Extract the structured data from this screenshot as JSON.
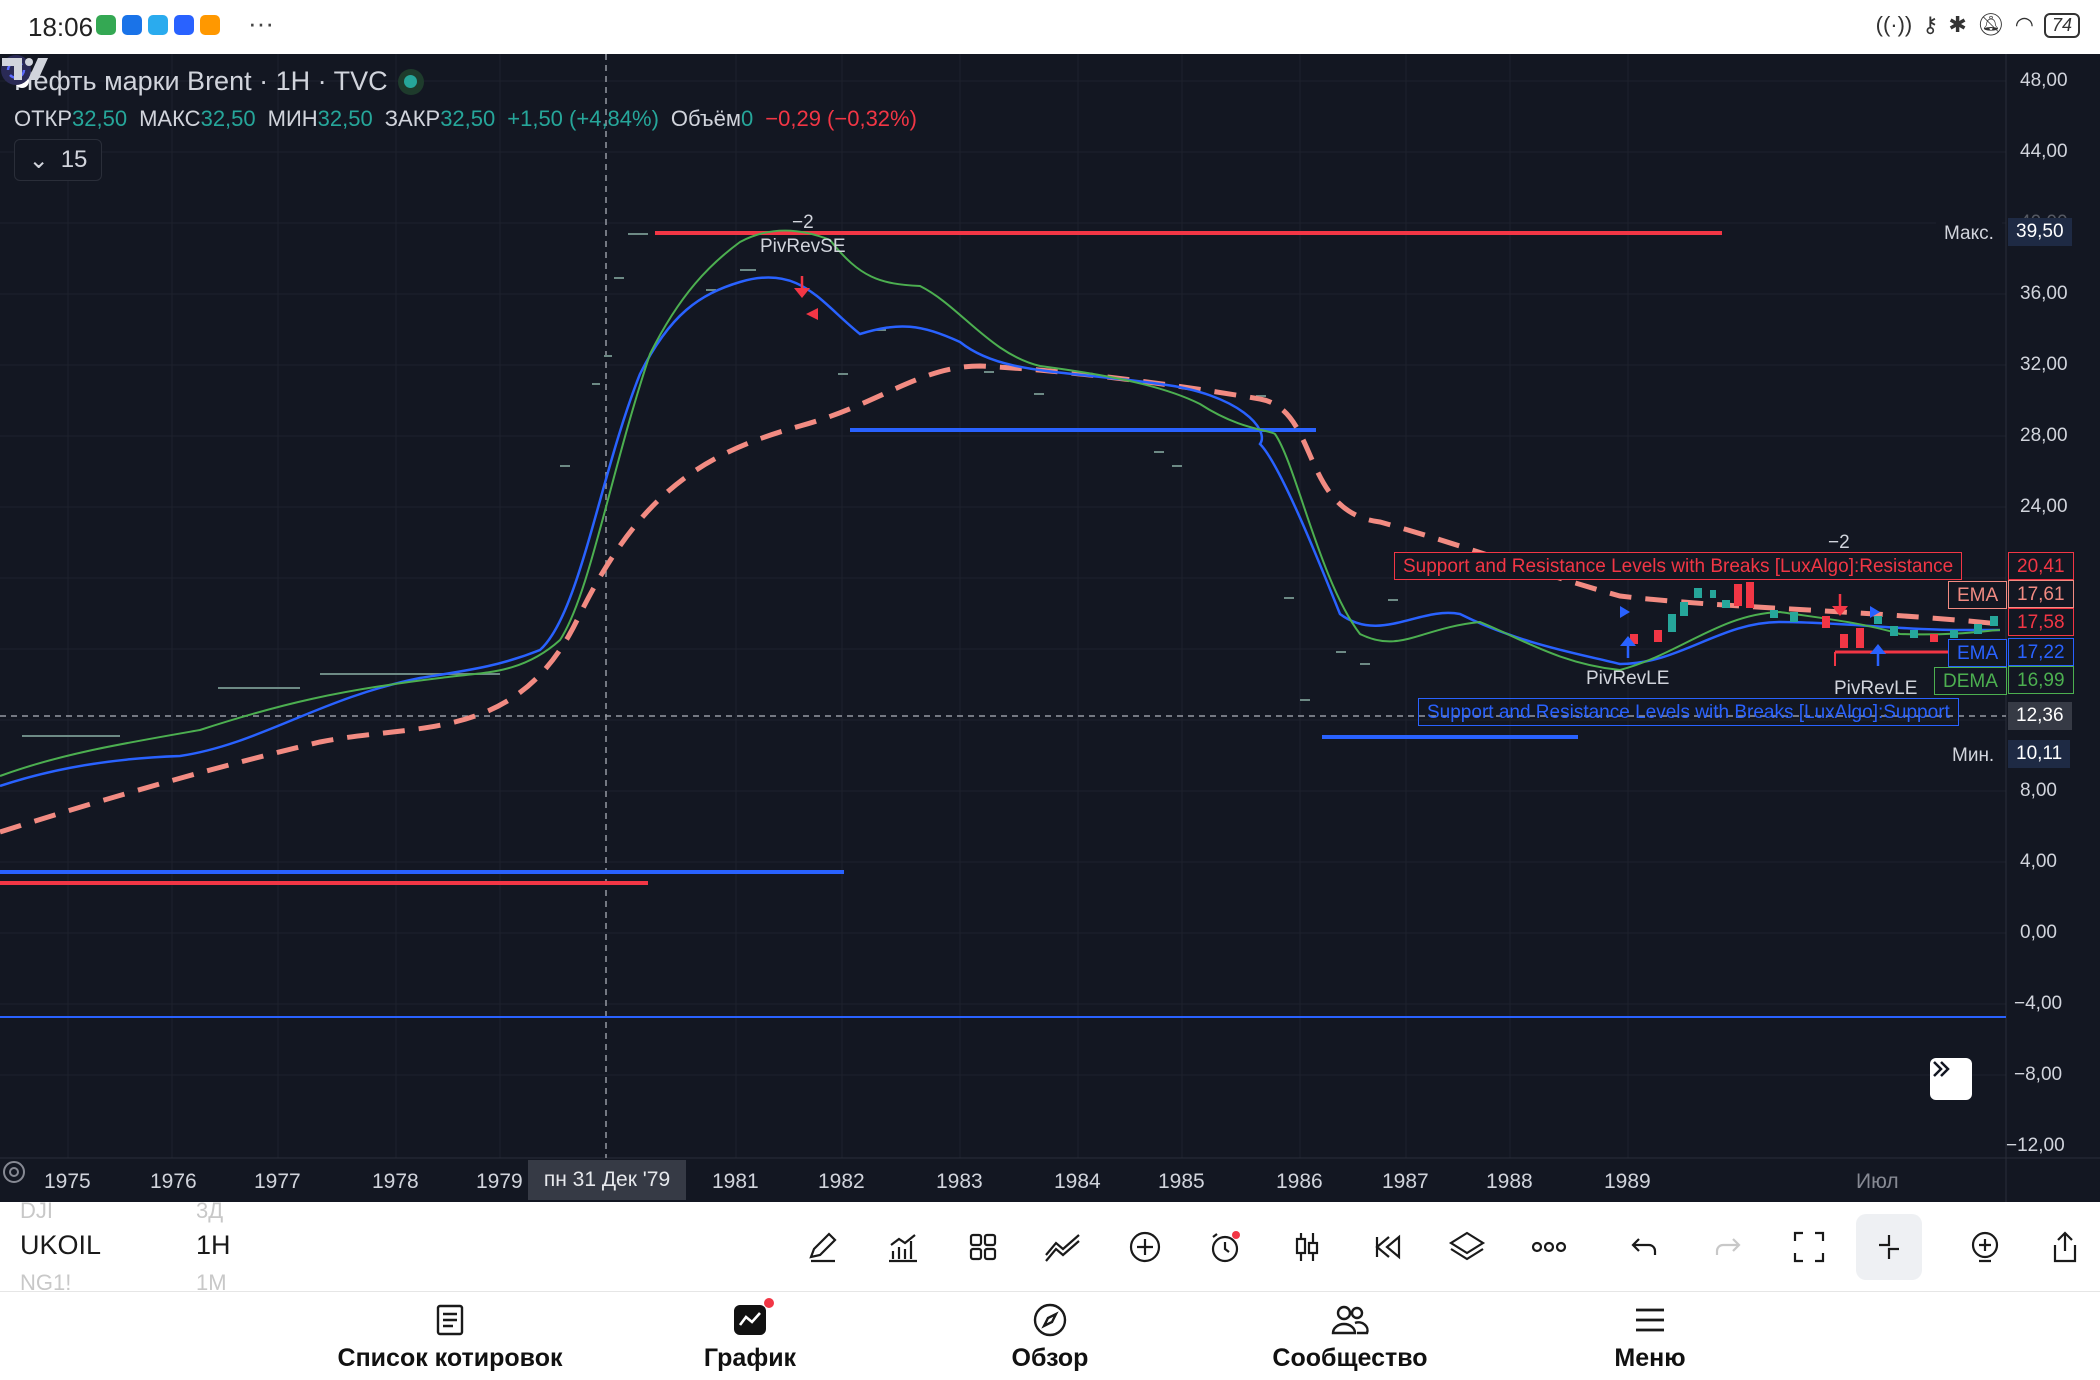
{
  "status_bar": {
    "time": "18:06",
    "more": "···",
    "battery": "74",
    "app_icon_colors": [
      "#34a853",
      "#1a73e8",
      "#2aabee",
      "#2962ff",
      "#ff9800"
    ]
  },
  "chart": {
    "symbol_title": "Нефть марки Brent · 1H · TVC",
    "ohlc": {
      "open_label": "ОТКР",
      "open": "32,50",
      "high_label": "МАКС",
      "high": "32,50",
      "low_label": "МИН",
      "low": "32,50",
      "close_label": "ЗАКР",
      "close": "32,50",
      "change": "+1,50 (+4,84%)",
      "volume_label": "Объём",
      "volume": "0",
      "volume_change": "−0,29 (−0,32%)"
    },
    "indicators_count": "15",
    "annotations": {
      "pivrevse_count": "−2",
      "pivrevse": "PivRevSE",
      "pivrevle_1": "PivRevLE",
      "pivrevle_2": "PivRevLE",
      "minus2_right": "−2",
      "sr_resistance": "Support and Resistance Levels with Breaks [LuxAlgo]:Resistance",
      "sr_support": "Support and Resistance Levels with Breaks [LuxAlgo]:Support"
    },
    "price_axis": [
      "48,00",
      "44,00",
      "40,00",
      "36,00",
      "32,00",
      "28,00",
      "24,00",
      "8,00",
      "4,00",
      "0,00",
      "−4,00",
      "−8,00",
      "−12,00"
    ],
    "price_tags": {
      "max_label": "Макс.",
      "max_value": "39,50",
      "resistance_value": "20,41",
      "ema1_label": "EMA",
      "ema1_value": "17,61",
      "red_value": "17,58",
      "ema2_label": "EMA",
      "ema2_value": "17,22",
      "dema_label": "DEMA",
      "dema_value": "16,99",
      "cross_value": "12,36",
      "min_label": "Мин.",
      "min_value": "10,11"
    },
    "time_axis": [
      "1975",
      "1976",
      "1977",
      "1978",
      "1979",
      "1981",
      "1982",
      "1983",
      "1984",
      "1985",
      "1986",
      "1987",
      "1988",
      "1989",
      "Июл"
    ],
    "crosshair_date": "пн 31 Дек '79",
    "colors": {
      "background": "#131722",
      "ema_green": "#4caf50",
      "ema_blue": "#2962ff",
      "dema_dashed": "#f28b82",
      "resistance": "#f23645",
      "support": "#2962ff"
    }
  },
  "toolbar": {
    "ghost_prev_symbol": "DJI",
    "ghost_prev_tf": "3Д",
    "symbol": "UKOIL",
    "timeframe": "1H",
    "ghost_next_symbol": "NG1!",
    "ghost_next_tf": "1M"
  },
  "nav": {
    "watchlist": "Список котировок",
    "chart": "График",
    "explore": "Обзор",
    "community": "Сообщество",
    "menu": "Меню"
  }
}
